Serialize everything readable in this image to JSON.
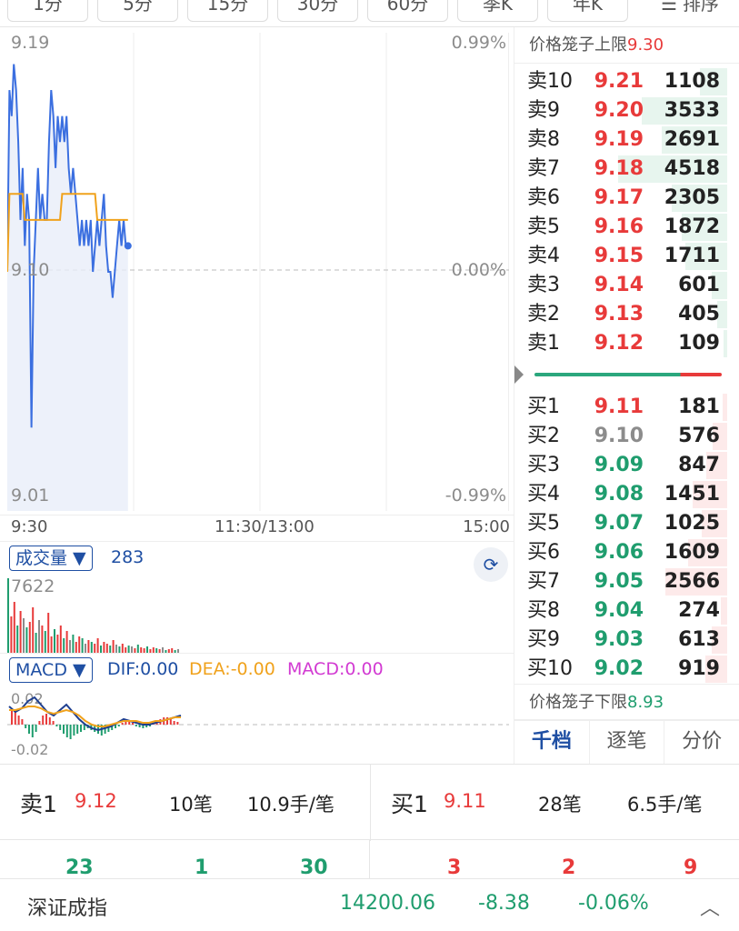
{
  "tabs": [
    "1分",
    "5分",
    "15分",
    "30分",
    "60分",
    "季K",
    "年K"
  ],
  "sort": {
    "icon": "menu-icon",
    "label": "排序"
  },
  "price_chart": {
    "y_high": "9.19",
    "y_mid": "9.10",
    "y_low": "9.01",
    "pct_high": "0.99%",
    "pct_mid": "0.00%",
    "pct_low": "-0.99%",
    "time_start": "9:30",
    "time_mid": "11:30/13:00",
    "time_end": "15:00",
    "line_color": "#3b6fe0",
    "avg_color": "#f0a21c"
  },
  "chart_data": {
    "type": "line",
    "ylim": [
      9.01,
      9.19
    ],
    "series": [
      {
        "values": [
          9.1,
          9.17,
          9.16,
          9.18,
          9.17,
          9.15,
          9.12,
          9.14,
          9.11,
          9.13,
          9.12,
          9.04,
          9.1,
          9.12,
          9.14,
          9.12,
          9.13,
          9.12,
          9.12,
          9.15,
          9.17,
          9.16,
          9.14,
          9.16,
          9.15,
          9.16,
          9.15,
          9.16,
          9.14,
          9.13,
          9.14,
          9.13,
          9.12,
          9.11,
          9.12,
          9.11,
          9.12,
          9.11,
          9.12,
          9.1,
          9.11,
          9.12,
          9.11,
          9.12,
          9.13,
          9.11,
          9.1,
          9.1,
          9.09,
          9.1,
          9.11,
          9.12,
          9.11,
          9.12,
          9.11,
          9.11
        ]
      },
      {
        "values": [
          9.1,
          9.13,
          9.13,
          9.13,
          9.13,
          9.13,
          9.13,
          9.13,
          9.12,
          9.12,
          9.12,
          9.12,
          9.12,
          9.12,
          9.12,
          9.12,
          9.12,
          9.12,
          9.12,
          9.12,
          9.12,
          9.12,
          9.12,
          9.12,
          9.12,
          9.13,
          9.13,
          9.13,
          9.13,
          9.13,
          9.13,
          9.13,
          9.13,
          9.13,
          9.13,
          9.13,
          9.13,
          9.13,
          9.13,
          9.13,
          9.13,
          9.12,
          9.12,
          9.12,
          9.12,
          9.12,
          9.12,
          9.12,
          9.12,
          9.12,
          9.12,
          9.12,
          9.12,
          9.12,
          9.12,
          9.12
        ]
      }
    ]
  },
  "volume": {
    "label": "成交量 ▼",
    "value": "283",
    "max": "7622",
    "rotate_icon": "rotate-screen-icon"
  },
  "macd": {
    "label": "MACD ▼",
    "dif": "DIF:0.00",
    "dea": "DEA:-0.00",
    "macd": "MACD:0.00",
    "top": "0.02",
    "bottom": "-0.02"
  },
  "book": {
    "upper_limit_label": "价格笼子上限",
    "upper_limit_value": "9.30",
    "lower_limit_label": "价格笼子下限",
    "lower_limit_value": "8.93",
    "asks": [
      {
        "label": "卖10",
        "price": "9.21",
        "qty": "1108",
        "depth": 0.25
      },
      {
        "label": "卖9",
        "price": "9.20",
        "qty": "3533",
        "depth": 0.78
      },
      {
        "label": "卖8",
        "price": "9.19",
        "qty": "2691",
        "depth": 0.6
      },
      {
        "label": "卖7",
        "price": "9.18",
        "qty": "4518",
        "depth": 1.0
      },
      {
        "label": "卖6",
        "price": "9.17",
        "qty": "2305",
        "depth": 0.51
      },
      {
        "label": "卖5",
        "price": "9.16",
        "qty": "1872",
        "depth": 0.42
      },
      {
        "label": "卖4",
        "price": "9.15",
        "qty": "1711",
        "depth": 0.38
      },
      {
        "label": "卖3",
        "price": "9.14",
        "qty": "601",
        "depth": 0.14
      },
      {
        "label": "卖2",
        "price": "9.13",
        "qty": "405",
        "depth": 0.09
      },
      {
        "label": "卖1",
        "price": "9.12",
        "qty": "109",
        "depth": 0.03
      }
    ],
    "bids": [
      {
        "label": "买1",
        "price": "9.11",
        "qty": "181",
        "depth": 0.04,
        "color": "red"
      },
      {
        "label": "买2",
        "price": "9.10",
        "qty": "576",
        "depth": 0.13,
        "color": "gray"
      },
      {
        "label": "买3",
        "price": "9.09",
        "qty": "847",
        "depth": 0.19,
        "color": "green"
      },
      {
        "label": "买4",
        "price": "9.08",
        "qty": "1451",
        "depth": 0.32,
        "color": "green"
      },
      {
        "label": "买5",
        "price": "9.07",
        "qty": "1025",
        "depth": 0.23,
        "color": "green"
      },
      {
        "label": "买6",
        "price": "9.06",
        "qty": "1609",
        "depth": 0.36,
        "color": "green"
      },
      {
        "label": "买7",
        "price": "9.05",
        "qty": "2566",
        "depth": 0.57,
        "color": "green"
      },
      {
        "label": "买8",
        "price": "9.04",
        "qty": "274",
        "depth": 0.06,
        "color": "green"
      },
      {
        "label": "买9",
        "price": "9.03",
        "qty": "613",
        "depth": 0.14,
        "color": "green"
      },
      {
        "label": "买10",
        "price": "9.02",
        "qty": "919",
        "depth": 0.2,
        "color": "green"
      }
    ],
    "tabs": [
      "千档",
      "逐笔",
      "分价"
    ]
  },
  "summary": {
    "sell_label": "卖1",
    "sell_price": "9.12",
    "sell_orders": "10笔",
    "sell_avg": "10.9手/笔",
    "buy_label": "买1",
    "buy_price": "9.11",
    "buy_orders": "28笔",
    "buy_avg": "6.5手/笔",
    "counts": [
      "23",
      "1",
      "30",
      "3",
      "2",
      "9"
    ]
  },
  "index": {
    "name": "深证成指",
    "value": "14200.06",
    "change": "-8.38",
    "pct": "-0.06%",
    "chevron": "chevron-up-icon"
  }
}
